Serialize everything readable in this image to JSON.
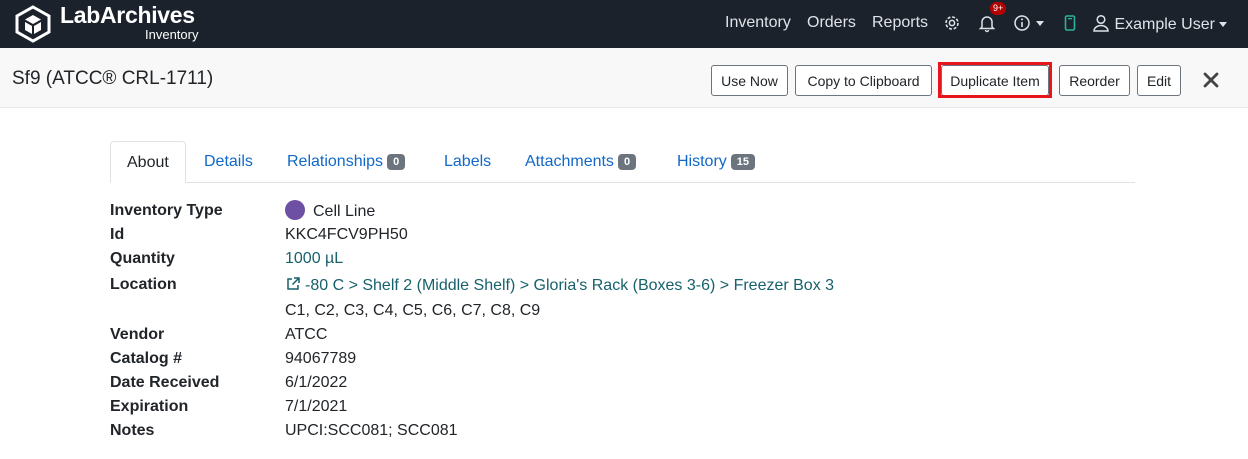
{
  "nav": {
    "brand": "LabArchives",
    "brand_sub": "Inventory",
    "links": [
      "Inventory",
      "Orders",
      "Reports"
    ],
    "notifications_badge": "9+",
    "user": "Example User",
    "bg_color": "#1b222c"
  },
  "header": {
    "title": "Sf9 (ATCC® CRL-1711)",
    "buttons": {
      "use_now": "Use Now",
      "copy": "Copy to Clipboard",
      "duplicate": "Duplicate Item",
      "reorder": "Reorder",
      "edit": "Edit"
    },
    "highlight_color": "#e8151b"
  },
  "tabs": [
    {
      "label": "About",
      "active": true
    },
    {
      "label": "Details"
    },
    {
      "label": "Relationships",
      "count": "0"
    },
    {
      "label": "Labels"
    },
    {
      "label": "Attachments",
      "count": "0"
    },
    {
      "label": "History",
      "count": "15"
    }
  ],
  "details": {
    "inventory_type": {
      "label": "Inventory Type",
      "value": "Cell Line",
      "color": "#6d4fa3"
    },
    "id": {
      "label": "Id",
      "value": "KKC4FCV9PH50"
    },
    "quantity": {
      "label": "Quantity",
      "value": "1000 µL"
    },
    "location": {
      "label": "Location",
      "value": "-80 C > Shelf 2 (Middle Shelf) > Gloria's Rack (Boxes 3-6) > Freezer Box 3",
      "positions": "C1, C2, C3, C4, C5, C6, C7, C8, C9"
    },
    "vendor": {
      "label": "Vendor",
      "value": "ATCC"
    },
    "catalog": {
      "label": "Catalog #",
      "value": "94067789"
    },
    "date_received": {
      "label": "Date Received",
      "value": "6/1/2022"
    },
    "expiration": {
      "label": "Expiration",
      "value": "7/1/2021"
    },
    "notes": {
      "label": "Notes",
      "value": "UPCI:SCC081; SCC081"
    }
  }
}
